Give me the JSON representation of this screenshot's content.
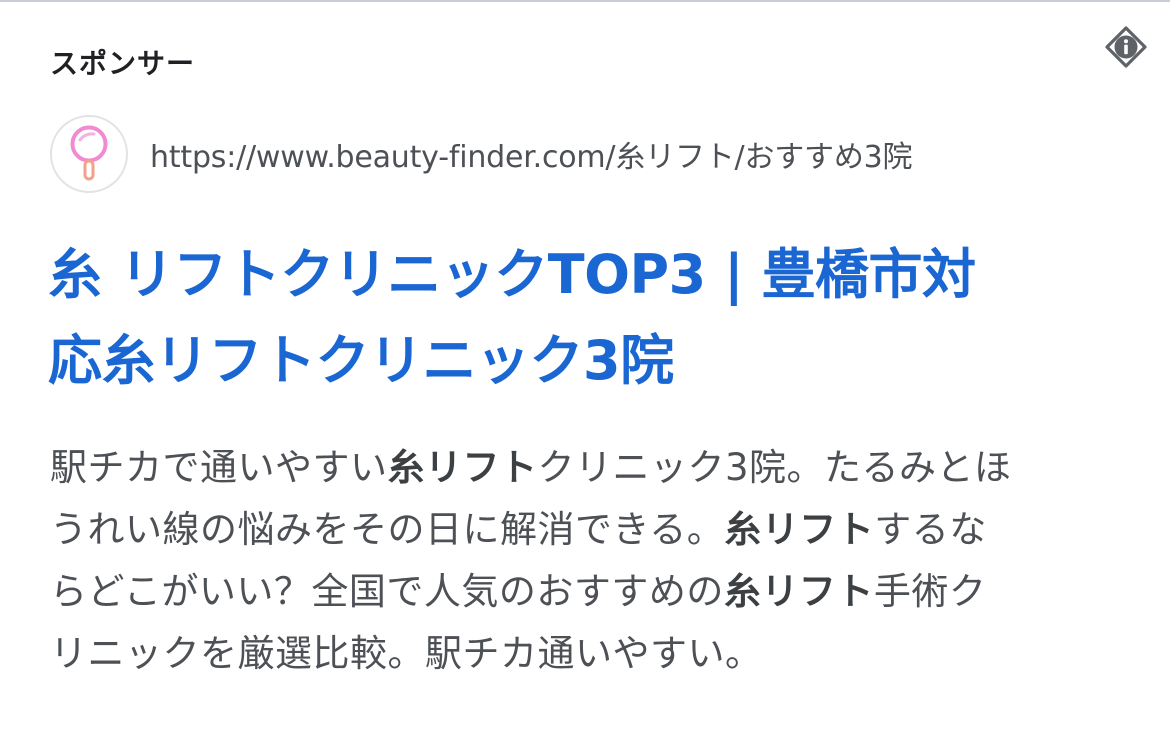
{
  "sponsor_label": "スポンサー",
  "icons": {
    "info": "info-icon",
    "favicon": "magnifier-heart-logo"
  },
  "colors": {
    "title": "#1a66d2",
    "body_text": "#4d5156",
    "favicon_pink": "#f08bd2"
  },
  "ad": {
    "url": "https://www.beauty-finder.com/糸リフト/おすすめ3院",
    "title_line1": "糸 リフトクリニックTOP3 | 豊橋市対",
    "title_line2": "応糸リフトクリニック3院",
    "description": {
      "l1_a": "駅チカで通いやすい",
      "l1_b": "糸リフト",
      "l1_c": "クリニック3院。たるみとほ",
      "l2_a": "うれい線の悩みをその日に解消できる。",
      "l2_b": "糸リフト",
      "l2_c": "するな",
      "l3_a": "らどこがいい？全国で人気のおすすめの",
      "l3_b": "糸リフト",
      "l3_c": "手術ク",
      "l4_a": "リニックを厳選比較。駅チカ通いやすい。"
    }
  }
}
